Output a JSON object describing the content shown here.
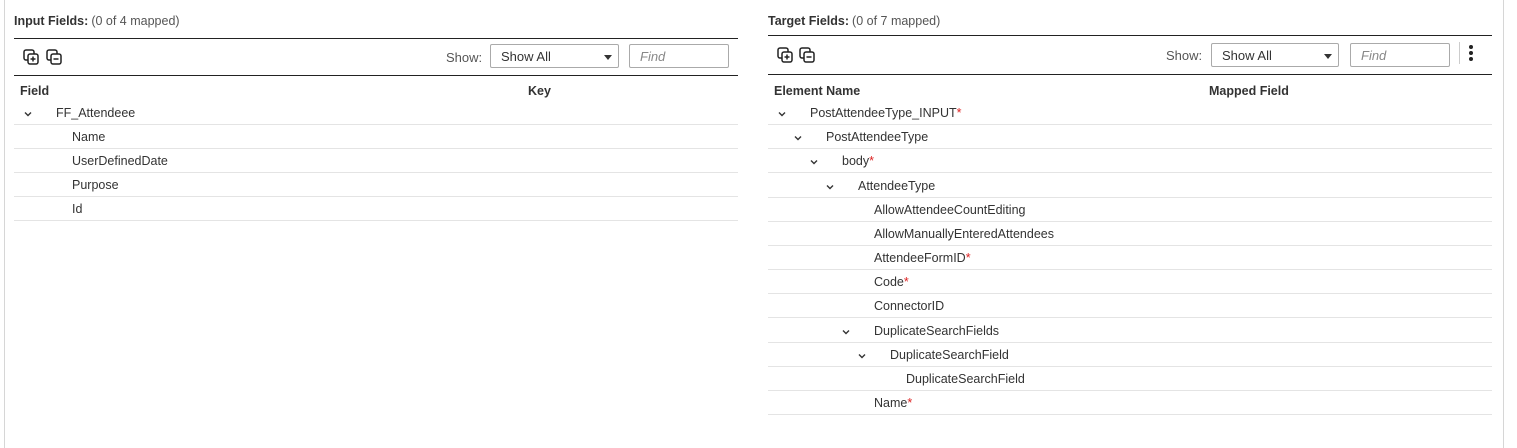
{
  "input_panel": {
    "title": "Input Fields:",
    "count": "(0 of 4 mapped)",
    "show_label": "Show:",
    "show_value": "Show All",
    "find_placeholder": "Find",
    "columns": [
      "Field",
      "Key"
    ],
    "rows": [
      {
        "label": "FF_Attendeee",
        "depth": 0,
        "expandable": true,
        "required": false
      },
      {
        "label": "Name",
        "depth": 1,
        "expandable": false,
        "required": false
      },
      {
        "label": "UserDefinedDate",
        "depth": 1,
        "expandable": false,
        "required": false
      },
      {
        "label": "Purpose",
        "depth": 1,
        "expandable": false,
        "required": false
      },
      {
        "label": "Id",
        "depth": 1,
        "expandable": false,
        "required": false
      }
    ]
  },
  "target_panel": {
    "title": "Target Fields:",
    "count": "(0 of 7 mapped)",
    "show_label": "Show:",
    "show_value": "Show All",
    "find_placeholder": "Find",
    "columns": [
      "Element Name",
      "Mapped Field"
    ],
    "rows": [
      {
        "label": "PostAttendeeType_INPUT",
        "depth": 0,
        "expandable": true,
        "required": true
      },
      {
        "label": "PostAttendeeType",
        "depth": 1,
        "expandable": true,
        "required": false
      },
      {
        "label": "body",
        "depth": 2,
        "expandable": true,
        "required": true
      },
      {
        "label": "AttendeeType",
        "depth": 3,
        "expandable": true,
        "required": false
      },
      {
        "label": "AllowAttendeeCountEditing",
        "depth": 4,
        "expandable": false,
        "required": false
      },
      {
        "label": "AllowManuallyEnteredAttendees",
        "depth": 4,
        "expandable": false,
        "required": false
      },
      {
        "label": "AttendeeFormID",
        "depth": 4,
        "expandable": false,
        "required": true
      },
      {
        "label": "Code",
        "depth": 4,
        "expandable": false,
        "required": true
      },
      {
        "label": "ConnectorID",
        "depth": 4,
        "expandable": false,
        "required": false
      },
      {
        "label": "DuplicateSearchFields",
        "depth": 4,
        "expandable": true,
        "required": false
      },
      {
        "label": "DuplicateSearchField",
        "depth": 5,
        "expandable": true,
        "required": false
      },
      {
        "label": "DuplicateSearchField",
        "depth": 6,
        "expandable": false,
        "required": false
      },
      {
        "label": "Name",
        "depth": 4,
        "expandable": false,
        "required": true
      }
    ]
  },
  "required_marker": "*",
  "icons": {
    "expand_all": "expand-all-icon",
    "collapse_all": "collapse-all-icon",
    "chevron": "chevron-down-icon",
    "more": "more-vertical-icon"
  },
  "colors": {
    "required": "#dd2222",
    "border": "#222222",
    "row_divider": "#e4e4e4"
  }
}
